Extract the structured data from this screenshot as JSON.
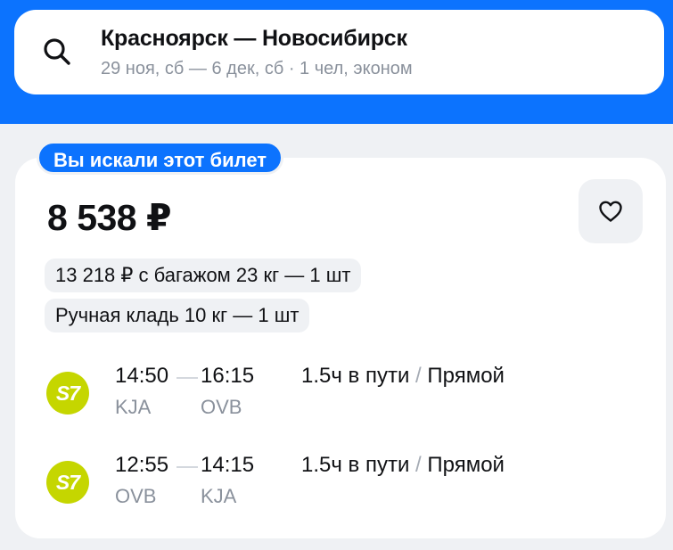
{
  "search": {
    "route": "Красноярск — Новосибирск",
    "details": "29 ноя, сб — 6 дек, сб · 1 чел, эконом",
    "icon": "search-icon"
  },
  "ticket": {
    "badge": "Вы искали этот билет",
    "price": "8 538 ₽",
    "favorite_icon": "heart-icon",
    "baggage_option": "13 218 ₽ с багажом 23 кг — 1 шт",
    "carry_on": "Ручная кладь 10 кг — 1 шт",
    "segments": [
      {
        "airline_logo": "S7",
        "dep_time": "14:50",
        "arr_time": "16:15",
        "dep_code": "KJA",
        "arr_code": "OVB",
        "duration": "1.5ч в пути",
        "separator": "/",
        "type": "Прямой"
      },
      {
        "airline_logo": "S7",
        "dep_time": "12:55",
        "arr_time": "14:15",
        "dep_code": "OVB",
        "arr_code": "KJA",
        "duration": "1.5ч в пути",
        "separator": "/",
        "type": "Прямой"
      }
    ]
  },
  "colors": {
    "brand_blue": "#0c73fe",
    "airline_green": "#c5d600",
    "muted_text": "#8a919c",
    "background": "#eff1f4"
  }
}
